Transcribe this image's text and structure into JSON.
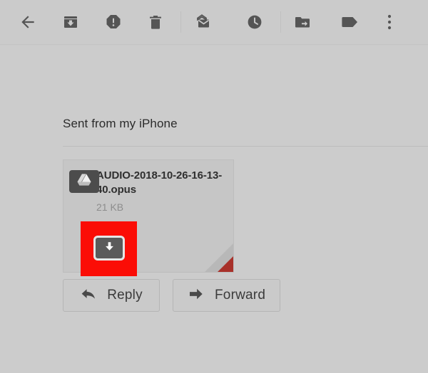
{
  "toolbar": {
    "icons": [
      {
        "name": "back-arrow-icon",
        "label": "Back"
      },
      {
        "name": "archive-icon",
        "label": "Archive"
      },
      {
        "name": "report-spam-icon",
        "label": "Report spam"
      },
      {
        "name": "delete-icon",
        "label": "Delete"
      },
      {
        "name": "mark-unread-icon",
        "label": "Mark as unread"
      },
      {
        "name": "snooze-clock-icon",
        "label": "Snooze"
      },
      {
        "name": "move-to-folder-icon",
        "label": "Move to"
      },
      {
        "name": "label-tag-icon",
        "label": "Labels"
      },
      {
        "name": "more-options-icon",
        "label": "More"
      }
    ]
  },
  "message": {
    "signature": "Sent from my iPhone"
  },
  "attachment": {
    "file_name": "AUDIO-2018-10-26-16-13-40.opus",
    "file_size": "21 KB",
    "file_type_icon": "audio-headphones-icon",
    "download_icon": "download-arrow-icon",
    "drive_icon": "google-drive-icon"
  },
  "actions": {
    "reply_label": "Reply",
    "reply_icon": "reply-arrow-icon",
    "forward_label": "Forward",
    "forward_icon": "forward-arrow-icon"
  },
  "colors": {
    "background": "#cccccc",
    "toolbar": "#cbcbcb",
    "highlight": "#fb0d06",
    "icon": "#5a5a5a",
    "audio_red": "#cc2222",
    "fold_red": "#a8312a"
  }
}
